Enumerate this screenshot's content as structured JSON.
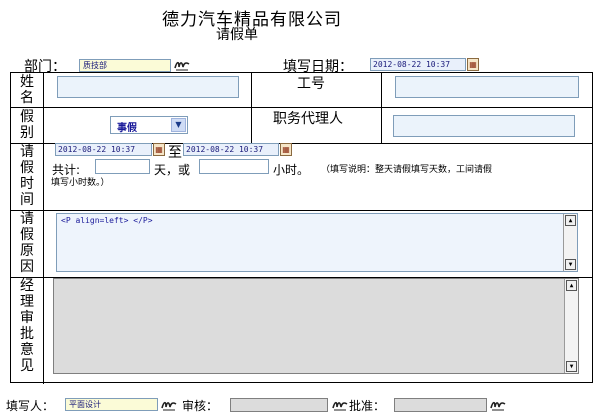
{
  "header": {
    "title": "德力汽车精品有限公司",
    "subtitle": "请假单"
  },
  "top_row": {
    "dept_label": "部门：",
    "dept_value": "质技部",
    "fill_date_label": "填写日期：",
    "fill_date_value": "2012-08-22 10:37",
    "calendar_glyph": "▦"
  },
  "form": {
    "name_label": "姓名",
    "employee_no_label": "工号",
    "leave_type_label": "假别",
    "leave_type_value": "事假",
    "leave_type_arrow": "▼",
    "agent_label": "职务代理人",
    "time_label": "请假时间",
    "start_date": "2012-08-22 10:37",
    "to_label": "至",
    "end_date": "2012-08-22 10:37",
    "total_label": "共计:",
    "days_label": "天，或",
    "hours_label": "小时。",
    "note_text": "（填写说明：整天请假填写天数，工间请假",
    "note_text_2": "填写小时数。）",
    "reason_label": "请假原因",
    "reason_value": "<P align=left> </P>",
    "manager_label": "经理审批意见",
    "scroll_up": "▲",
    "scroll_down": "▼"
  },
  "footer": {
    "filler_label": "填写人：",
    "filler_value": "平面设计",
    "review_label": "审核：",
    "approve_label": "批准："
  }
}
